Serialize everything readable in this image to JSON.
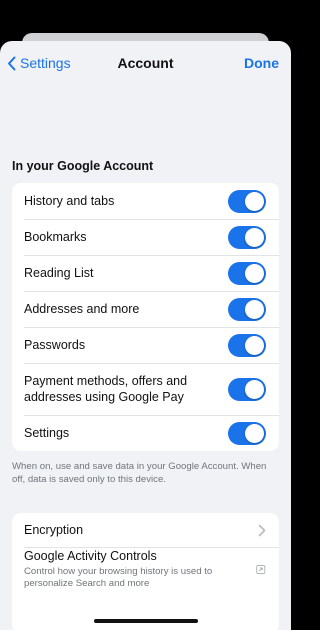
{
  "nav": {
    "back_label": "Settings",
    "title": "Account",
    "done_label": "Done"
  },
  "sync": {
    "section_title": "In your Google Account",
    "items": [
      {
        "label": "History and tabs",
        "on": true
      },
      {
        "label": "Bookmarks",
        "on": true
      },
      {
        "label": "Reading List",
        "on": true
      },
      {
        "label": "Addresses and more",
        "on": true
      },
      {
        "label": "Passwords",
        "on": true
      },
      {
        "label": "Payment methods, offers and addresses using Google Pay",
        "on": true
      },
      {
        "label": "Settings",
        "on": true
      }
    ],
    "footnote": "When on, use and save data in your Google Account. When off, data is saved only to this device."
  },
  "more": {
    "encryption_label": "Encryption",
    "activity_label": "Google Activity Controls",
    "activity_sub": "Control how your browsing history is used to personalize Search and more"
  },
  "colors": {
    "accent": "#1a73e8",
    "background": "#f1f2f6",
    "toggle_on": "#1a73e8"
  }
}
